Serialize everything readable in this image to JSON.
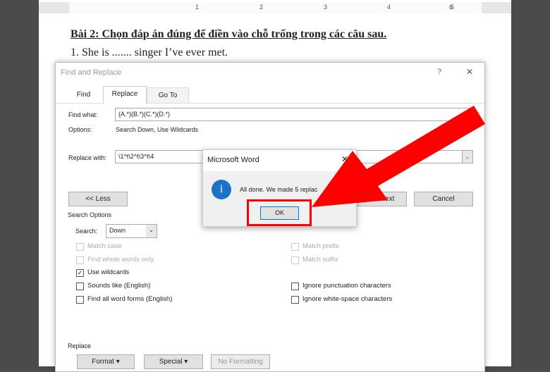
{
  "document": {
    "ruler_numbers": [
      "1",
      "2",
      "3",
      "4",
      "5",
      "6"
    ],
    "heading": "Bài 2: Chọn đáp án đúng để điền vào chỗ trống trong các câu sau.",
    "line1": "1. She is ....... singer I’ve ever met."
  },
  "dialog": {
    "title": "Find and Replace",
    "help": "?",
    "close": "✕",
    "tabs": [
      {
        "label": "Find"
      },
      {
        "label": "Replace",
        "active": true
      },
      {
        "label": "Go To"
      }
    ],
    "find_label": "Find what:",
    "find_value": "(A.*)(B.*)(C.*)(D.*)",
    "options_label": "Options:",
    "options_value": "Search Down, Use Wildcards",
    "replace_label": "Replace with:",
    "replace_value": "\\1^t\\2^t\\3^t\\4",
    "less_button": "<< Less",
    "find_next_button": "Find Next",
    "cancel_button": "Cancel",
    "search_options": "Search Options",
    "search_label": "Search:",
    "search_value": "Down",
    "checkboxes_left": [
      {
        "label": "Match case",
        "checked": false,
        "disabled": true
      },
      {
        "label": "Find whole words only",
        "checked": false,
        "disabled": true
      },
      {
        "label": "Use wildcards",
        "checked": true,
        "disabled": false
      },
      {
        "label": "Sounds like (English)",
        "checked": false,
        "disabled": false
      },
      {
        "label": "Find all word forms (English)",
        "checked": false,
        "disabled": false
      }
    ],
    "checkboxes_right": [
      {
        "label": "Match prefix",
        "checked": false,
        "disabled": true
      },
      {
        "label": "Match suffix",
        "checked": false,
        "disabled": true
      },
      {
        "label": "Ignore punctuation characters",
        "checked": false,
        "disabled": false
      },
      {
        "label": "Ignore white-space characters",
        "checked": false,
        "disabled": false
      }
    ],
    "replace_section": "Replace",
    "format_button": "Format ▾",
    "special_button": "Special ▾",
    "no_formatting_button": "No Formatting"
  },
  "popup": {
    "title": "Microsoft Word",
    "close": "✕",
    "icon": "info-icon",
    "message": "All done. We made 5 replac",
    "ok_button": "OK"
  },
  "colors": {
    "highlight": "#ff0000",
    "info": "#1a73c8"
  }
}
